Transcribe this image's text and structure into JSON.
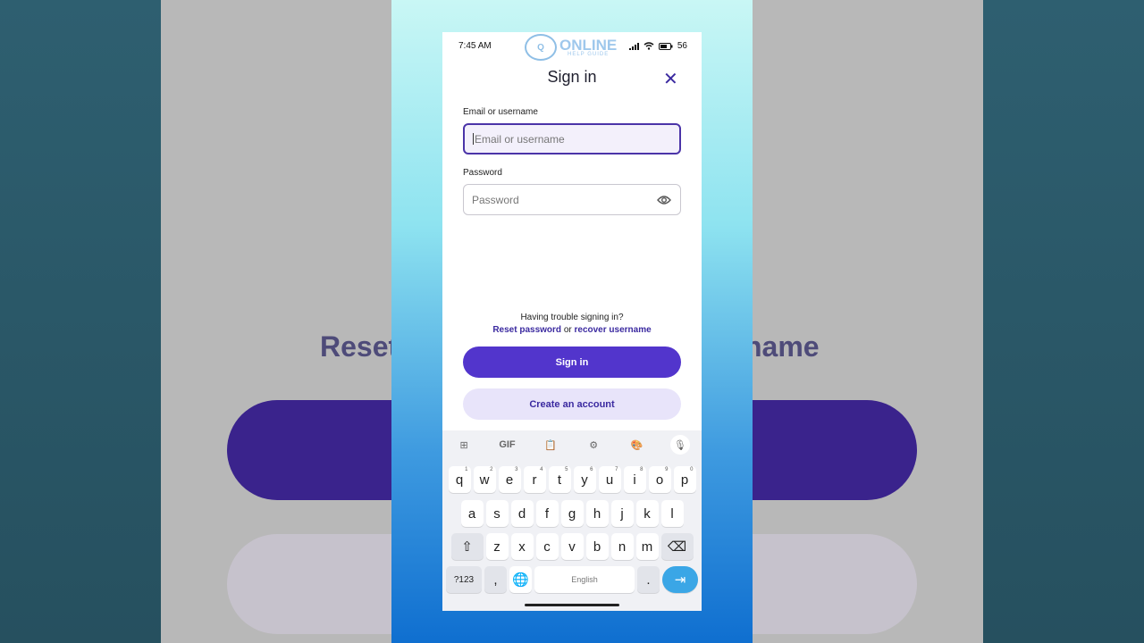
{
  "background": {
    "title_left": "Reset",
    "title_right": "name"
  },
  "status": {
    "time": "7:45 AM",
    "battery": "56"
  },
  "logo": {
    "main": "ONLINE",
    "sub": "HELP GUIDE"
  },
  "dialog": {
    "title": "Sign in",
    "email_label": "Email or username",
    "email_placeholder": "Email or username",
    "password_label": "Password",
    "password_placeholder": "Password",
    "trouble_text": "Having trouble signing in?",
    "reset_link": "Reset password",
    "or_text": "or",
    "recover_link": "recover username",
    "signin_button": "Sign in",
    "create_button": "Create an account"
  },
  "keyboard": {
    "toolbar": [
      "apps-icon",
      "GIF",
      "clipboard-icon",
      "gear-icon",
      "palette-icon",
      "mic-icon"
    ],
    "gif_label": "GIF",
    "row1": [
      [
        "q",
        "1"
      ],
      [
        "w",
        "2"
      ],
      [
        "e",
        "3"
      ],
      [
        "r",
        "4"
      ],
      [
        "t",
        "5"
      ],
      [
        "y",
        "6"
      ],
      [
        "u",
        "7"
      ],
      [
        "i",
        "8"
      ],
      [
        "o",
        "9"
      ],
      [
        "p",
        "0"
      ]
    ],
    "row2": [
      "a",
      "s",
      "d",
      "f",
      "g",
      "h",
      "j",
      "k",
      "l"
    ],
    "row3": [
      "z",
      "x",
      "c",
      "v",
      "b",
      "n",
      "m"
    ],
    "sym_label": "?123",
    "comma_label": ",",
    "space_label": "English",
    "period_label": "."
  }
}
